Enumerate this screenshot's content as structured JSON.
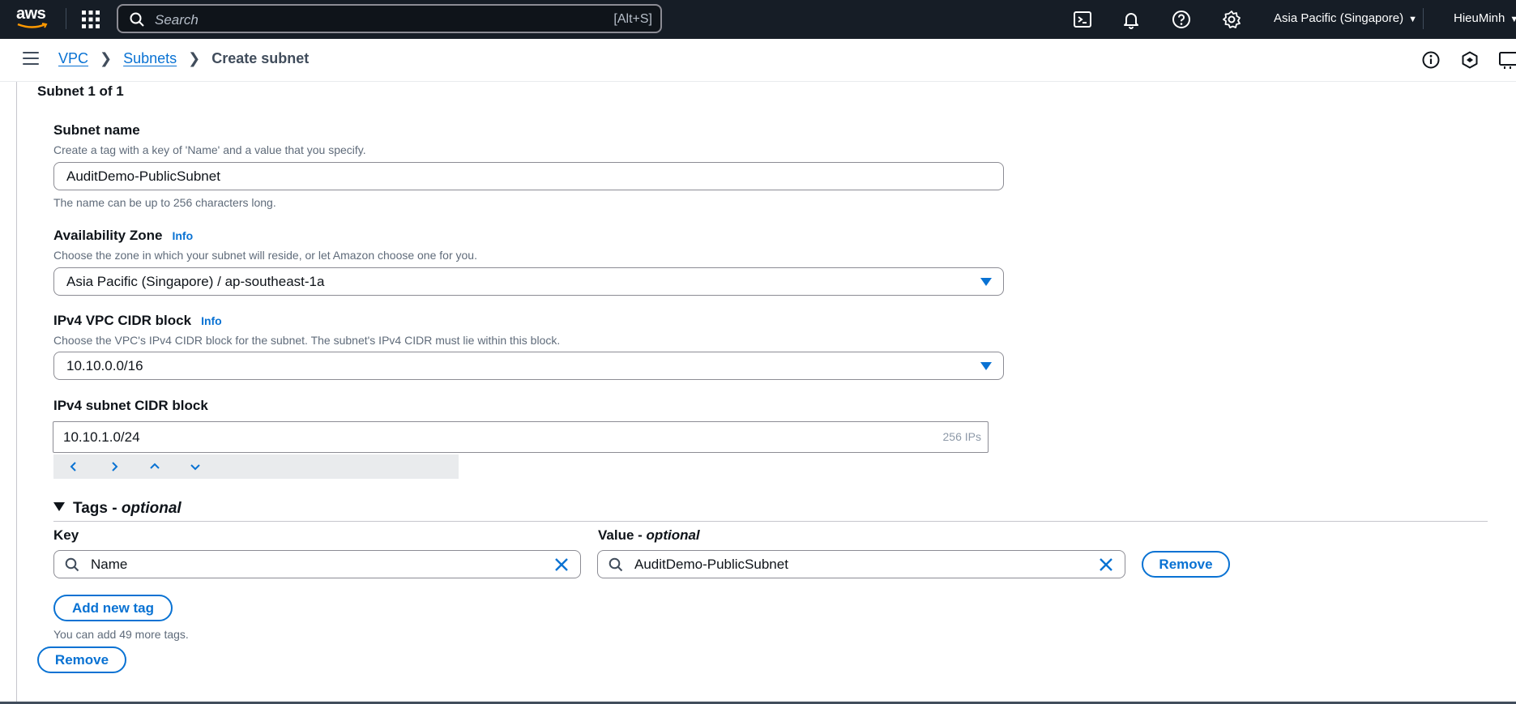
{
  "topnav": {
    "logo_text": "aws",
    "search": {
      "placeholder": "Search",
      "shortcut": "[Alt+S]"
    },
    "region": "Asia Pacific (Singapore)",
    "user": "HieuMinh"
  },
  "breadcrumb": {
    "items": [
      "VPC",
      "Subnets"
    ],
    "current": "Create subnet"
  },
  "subnet": {
    "header": "Subnet 1 of 1",
    "name": {
      "label": "Subnet name",
      "description": "Create a tag with a key of 'Name' and a value that you specify.",
      "value": "AuditDemo-PublicSubnet",
      "constraint": "The name can be up to 256 characters long."
    },
    "az": {
      "label": "Availability Zone",
      "info": "Info",
      "description": "Choose the zone in which your subnet will reside, or let Amazon choose one for you.",
      "value": "Asia Pacific (Singapore) / ap-southeast-1a"
    },
    "vpc_cidr": {
      "label": "IPv4 VPC CIDR block",
      "info": "Info",
      "description": "Choose the VPC's IPv4 CIDR block for the subnet. The subnet's IPv4 CIDR must lie within this block.",
      "value": "10.10.0.0/16"
    },
    "subnet_cidr": {
      "label": "IPv4 subnet CIDR block",
      "value": "10.10.1.0/24",
      "ip_count": "256 IPs"
    },
    "tags": {
      "header": "Tags -",
      "header_optional": "optional",
      "key_label": "Key",
      "value_label": "Value -",
      "value_optional": "optional",
      "rows": [
        {
          "key": "Name",
          "value": "AuditDemo-PublicSubnet",
          "remove": "Remove"
        }
      ],
      "add_button": "Add new tag",
      "hint": "You can add 49 more tags."
    },
    "remove_subnet": "Remove"
  },
  "colors": {
    "nav_bg": "#161d26",
    "link": "#0972d3",
    "text": "#0f141a",
    "muted": "#5f6b7a"
  }
}
